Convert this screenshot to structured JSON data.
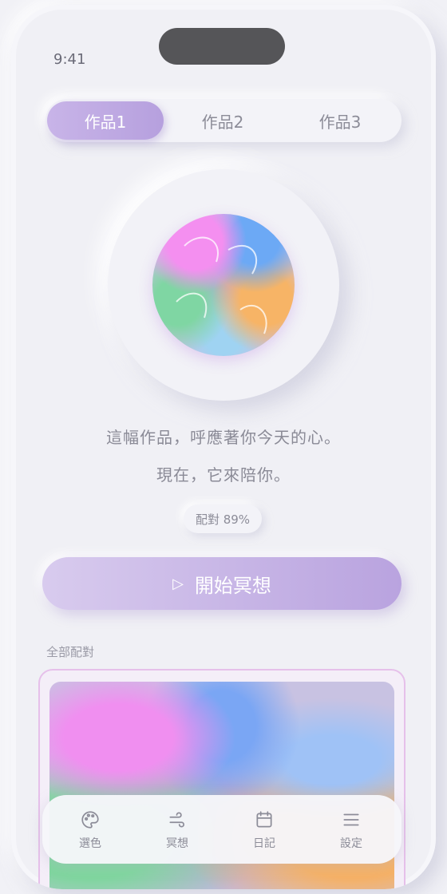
{
  "status_bar": {
    "time": "9:41"
  },
  "tabs": [
    {
      "label": "作品1",
      "active": true
    },
    {
      "label": "作品2",
      "active": false
    },
    {
      "label": "作品3",
      "active": false
    }
  ],
  "artwork": {
    "icon": "artwork-circle"
  },
  "message": {
    "line1": "這幅作品，呼應著你今天的心。",
    "line2": "現在，它來陪你。"
  },
  "match_badge": "配對 89%",
  "cta": {
    "icon": "play-icon",
    "label": "開始冥想"
  },
  "section_title": "全部配對",
  "nav": [
    {
      "icon": "palette-icon",
      "label": "選色"
    },
    {
      "icon": "wind-icon",
      "label": "冥想"
    },
    {
      "icon": "calendar-icon",
      "label": "日記"
    },
    {
      "icon": "menu-icon",
      "label": "設定"
    }
  ],
  "colors": {
    "accent": "#b9a3df",
    "background": "#f1f1f6",
    "text": "#8a8a96"
  }
}
